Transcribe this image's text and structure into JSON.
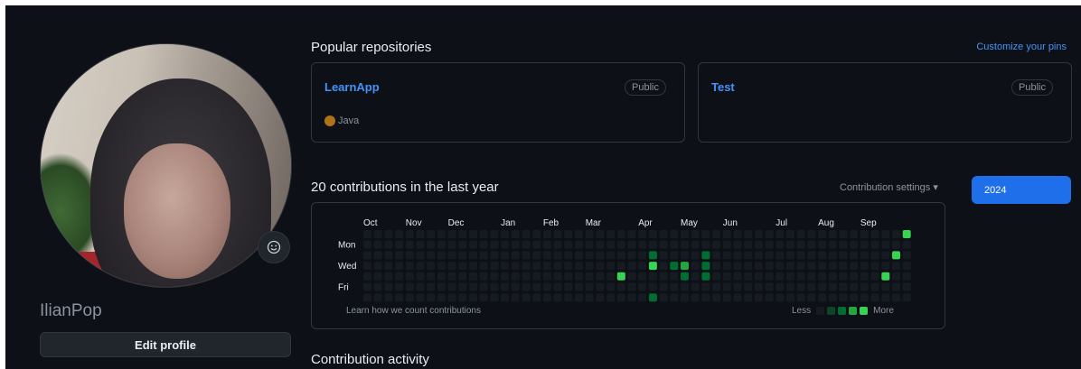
{
  "profile": {
    "username": "IlianPop",
    "edit_button": "Edit profile",
    "status_icon": "smiley-icon"
  },
  "repos": {
    "title": "Popular repositories",
    "customize": "Customize your pins",
    "items": [
      {
        "name": "LearnApp",
        "visibility": "Public",
        "language": "Java",
        "language_color": "#b07219"
      },
      {
        "name": "Test",
        "visibility": "Public",
        "language": "",
        "language_color": ""
      }
    ]
  },
  "contributions": {
    "title": "20 contributions in the last year",
    "settings": "Contribution settings",
    "settings_icon": "caret-down-icon",
    "year": "2024",
    "months": [
      "Oct",
      "Nov",
      "Dec",
      "Jan",
      "Feb",
      "Mar",
      "Apr",
      "May",
      "Jun",
      "Jul",
      "Aug",
      "Sep"
    ],
    "days": [
      "Mon",
      "Wed",
      "Fri"
    ],
    "learn": "Learn how we count contributions",
    "legend_less": "Less",
    "legend_more": "More",
    "colors": [
      "#161b22",
      "#0e4429",
      "#006d32",
      "#26a641",
      "#39d353"
    ],
    "active_cells": [
      {
        "week": 24,
        "day": 4,
        "level": 4
      },
      {
        "week": 27,
        "day": 2,
        "level": 2
      },
      {
        "week": 27,
        "day": 3,
        "level": 4
      },
      {
        "week": 27,
        "day": 6,
        "level": 2
      },
      {
        "week": 29,
        "day": 3,
        "level": 2
      },
      {
        "week": 30,
        "day": 3,
        "level": 3
      },
      {
        "week": 30,
        "day": 4,
        "level": 2
      },
      {
        "week": 32,
        "day": 2,
        "level": 2
      },
      {
        "week": 32,
        "day": 3,
        "level": 2
      },
      {
        "week": 32,
        "day": 4,
        "level": 2
      },
      {
        "week": 49,
        "day": 4,
        "level": 4
      },
      {
        "week": 50,
        "day": 2,
        "level": 4
      },
      {
        "week": 51,
        "day": 0,
        "level": 4
      }
    ]
  },
  "activity": {
    "title": "Contribution activity"
  }
}
